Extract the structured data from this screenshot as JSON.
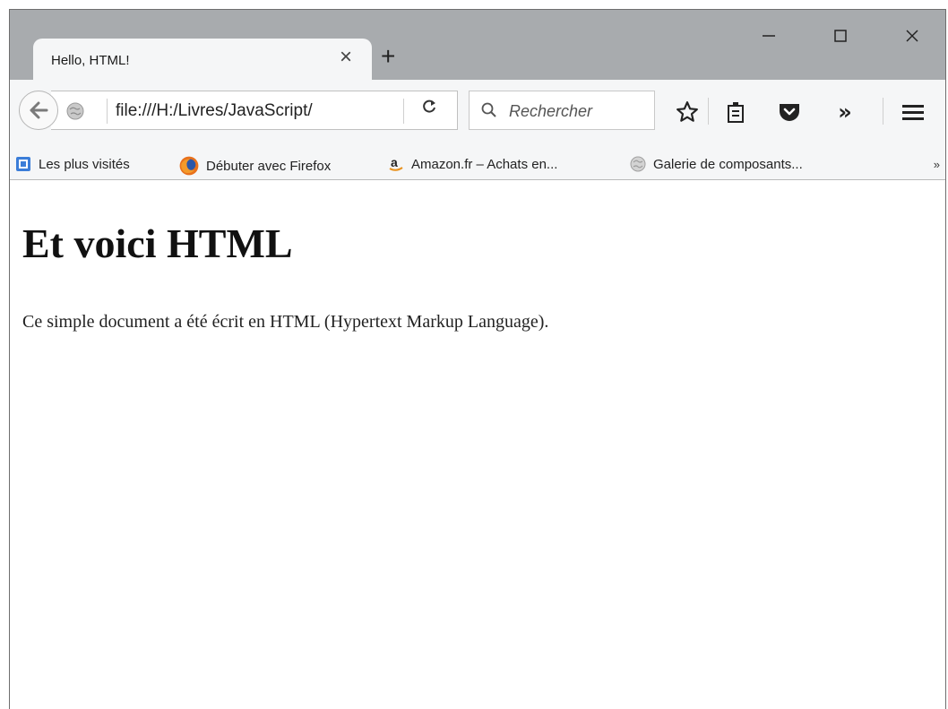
{
  "tab": {
    "title": "Hello, HTML!"
  },
  "navbar": {
    "url": "file:///H:/Livres/JavaScript/",
    "search_placeholder": "Rechercher"
  },
  "bookmarks": [
    {
      "label": "Les plus visités",
      "icon": "bookmarks-folder-icon"
    },
    {
      "label": "Débuter avec Firefox",
      "icon": "firefox-icon"
    },
    {
      "label": "Amazon.fr – Achats en...",
      "icon": "amazon-icon"
    },
    {
      "label": "Galerie de composants...",
      "icon": "globe-icon"
    }
  ],
  "page": {
    "heading": "Et voici HTML",
    "paragraph": "Ce simple document a été écrit en HTML (Hypertext Markup Language)."
  },
  "colors": {
    "titlebar": "#a8abae",
    "toolbar": "#f5f6f7",
    "firefox_orange": "#e8711c",
    "bookmarks_blue": "#3b7dd8"
  }
}
